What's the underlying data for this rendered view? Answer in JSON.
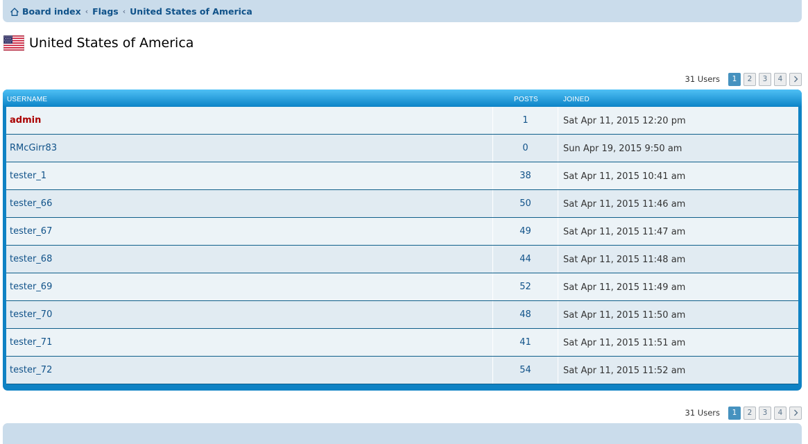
{
  "breadcrumbs": [
    {
      "label": "Board index"
    },
    {
      "label": "Flags"
    },
    {
      "label": "United States of America"
    }
  ],
  "title": "United States of America",
  "pagination": {
    "count_label": "31 Users",
    "pages": [
      "1",
      "2",
      "3",
      "4"
    ],
    "current": "1"
  },
  "table": {
    "headers": {
      "username": "USERNAME",
      "posts": "POSTS",
      "joined": "JOINED"
    },
    "rows": [
      {
        "username": "admin",
        "posts": "1",
        "joined": "Sat Apr 11, 2015 12:20 pm"
      },
      {
        "username": "RMcGirr83",
        "posts": "0",
        "joined": "Sun Apr 19, 2015 9:50 am"
      },
      {
        "username": "tester_1",
        "posts": "38",
        "joined": "Sat Apr 11, 2015 10:41 am"
      },
      {
        "username": "tester_66",
        "posts": "50",
        "joined": "Sat Apr 11, 2015 11:46 am"
      },
      {
        "username": "tester_67",
        "posts": "49",
        "joined": "Sat Apr 11, 2015 11:47 am"
      },
      {
        "username": "tester_68",
        "posts": "44",
        "joined": "Sat Apr 11, 2015 11:48 am"
      },
      {
        "username": "tester_69",
        "posts": "52",
        "joined": "Sat Apr 11, 2015 11:49 am"
      },
      {
        "username": "tester_70",
        "posts": "48",
        "joined": "Sat Apr 11, 2015 11:50 am"
      },
      {
        "username": "tester_71",
        "posts": "41",
        "joined": "Sat Apr 11, 2015 11:51 am"
      },
      {
        "username": "tester_72",
        "posts": "54",
        "joined": "Sat Apr 11, 2015 11:52 am"
      }
    ]
  },
  "colors": {
    "link": "#105289",
    "admin": "#aa0000",
    "header_blue": "#0f82c4",
    "navbar": "#cadceb"
  },
  "icons": {
    "home": "home-icon",
    "next": "chevron-right-icon",
    "flag": "us-flag-icon"
  }
}
